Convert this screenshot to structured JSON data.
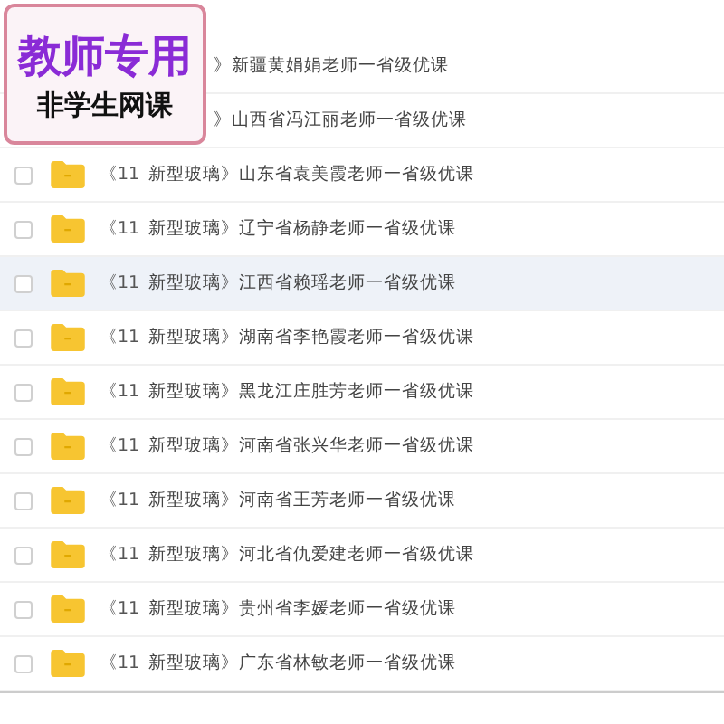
{
  "badge": {
    "title": "教师专用",
    "subtitle": "非学生网课"
  },
  "files": [
    {
      "title": "》新疆黄娟娟老师一省级优课",
      "highlighted": false
    },
    {
      "title": "》山西省冯江丽老师一省级优课",
      "highlighted": false
    },
    {
      "number": "《11",
      "title": "新型玻璃》山东省袁美霞老师一省级优课",
      "checked": false,
      "highlighted": false
    },
    {
      "number": "《11",
      "title": "新型玻璃》辽宁省杨静老师一省级优课",
      "checked": false,
      "highlighted": false
    },
    {
      "number": "《11",
      "title": "新型玻璃》江西省赖瑶老师一省级优课",
      "checked": false,
      "highlighted": true
    },
    {
      "number": "《11",
      "title": "新型玻璃》湖南省李艳霞老师一省级优课",
      "checked": false,
      "highlighted": false
    },
    {
      "number": "《11",
      "title": "新型玻璃》黑龙江庄胜芳老师一省级优课",
      "checked": false,
      "highlighted": false
    },
    {
      "number": "《11",
      "title": "新型玻璃》河南省张兴华老师一省级优课",
      "checked": false,
      "highlighted": false
    },
    {
      "number": "《11",
      "title": "新型玻璃》河南省王芳老师一省级优课",
      "checked": false,
      "highlighted": false
    },
    {
      "number": "《11",
      "title": "新型玻璃》河北省仇爱建老师一省级优课",
      "checked": false,
      "highlighted": false
    },
    {
      "number": "《11",
      "title": "新型玻璃》贵州省李媛老师一省级优课",
      "checked": false,
      "highlighted": false
    },
    {
      "number": "《11",
      "title": "新型玻璃》广东省林敏老师一省级优课",
      "checked": false,
      "highlighted": false
    }
  ]
}
